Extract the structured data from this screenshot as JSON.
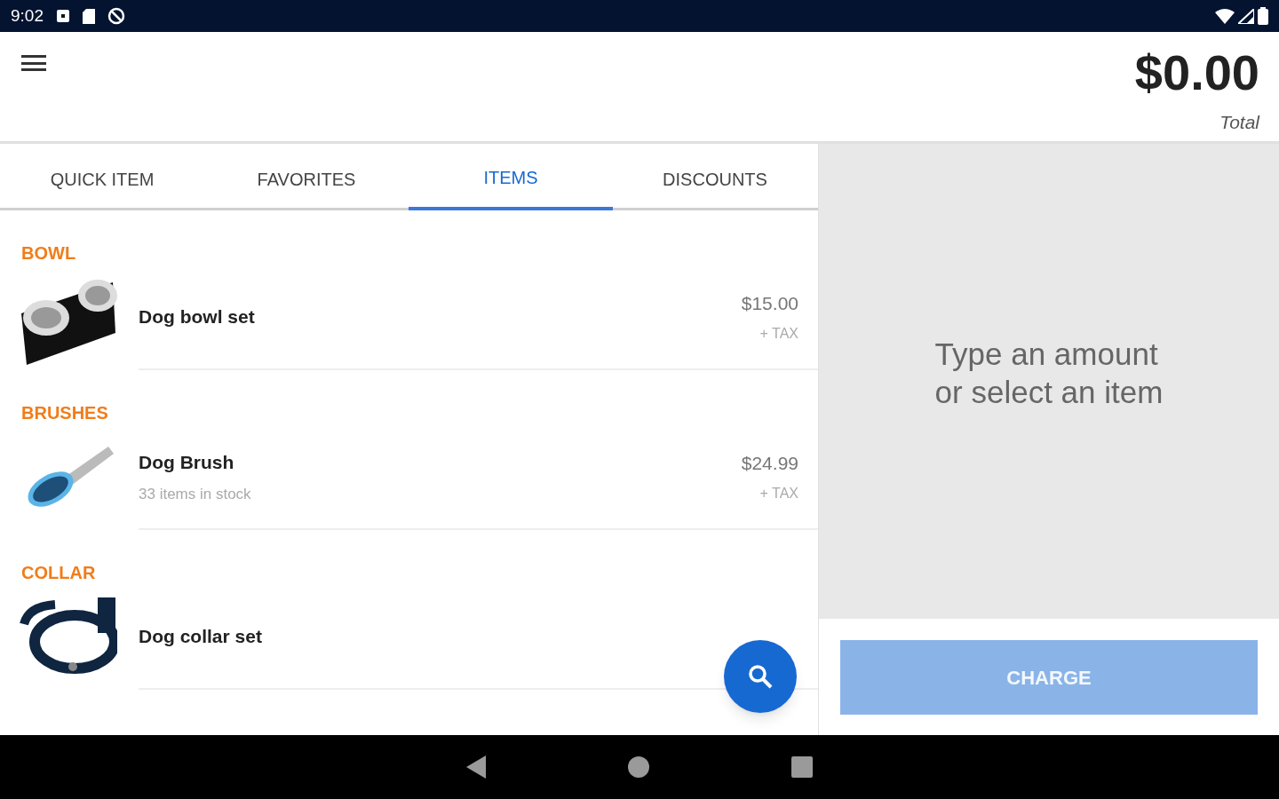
{
  "status_bar": {
    "time": "9:02"
  },
  "header": {
    "total": "$0.00",
    "total_label": "Total"
  },
  "tabs": [
    {
      "label": "QUICK ITEM",
      "selected": false
    },
    {
      "label": "FAVORITES",
      "selected": false
    },
    {
      "label": "ITEMS",
      "selected": true
    },
    {
      "label": "DISCOUNTS",
      "selected": false
    }
  ],
  "sections": [
    {
      "title": "BOWL",
      "items": [
        {
          "name": "Dog bowl set",
          "price": "$15.00",
          "tax": "+ TAX"
        }
      ]
    },
    {
      "title": "BRUSHES",
      "items": [
        {
          "name": "Dog Brush",
          "stock": "33 items in stock",
          "price": "$24.99",
          "tax": "+ TAX"
        }
      ]
    },
    {
      "title": "COLLAR",
      "items": [
        {
          "name": "Dog collar set"
        }
      ]
    }
  ],
  "cart": {
    "hint_lines": [
      "Type an amount",
      "or select an item"
    ],
    "charge_button": {
      "label": "CHARGE",
      "disabled": true
    }
  }
}
